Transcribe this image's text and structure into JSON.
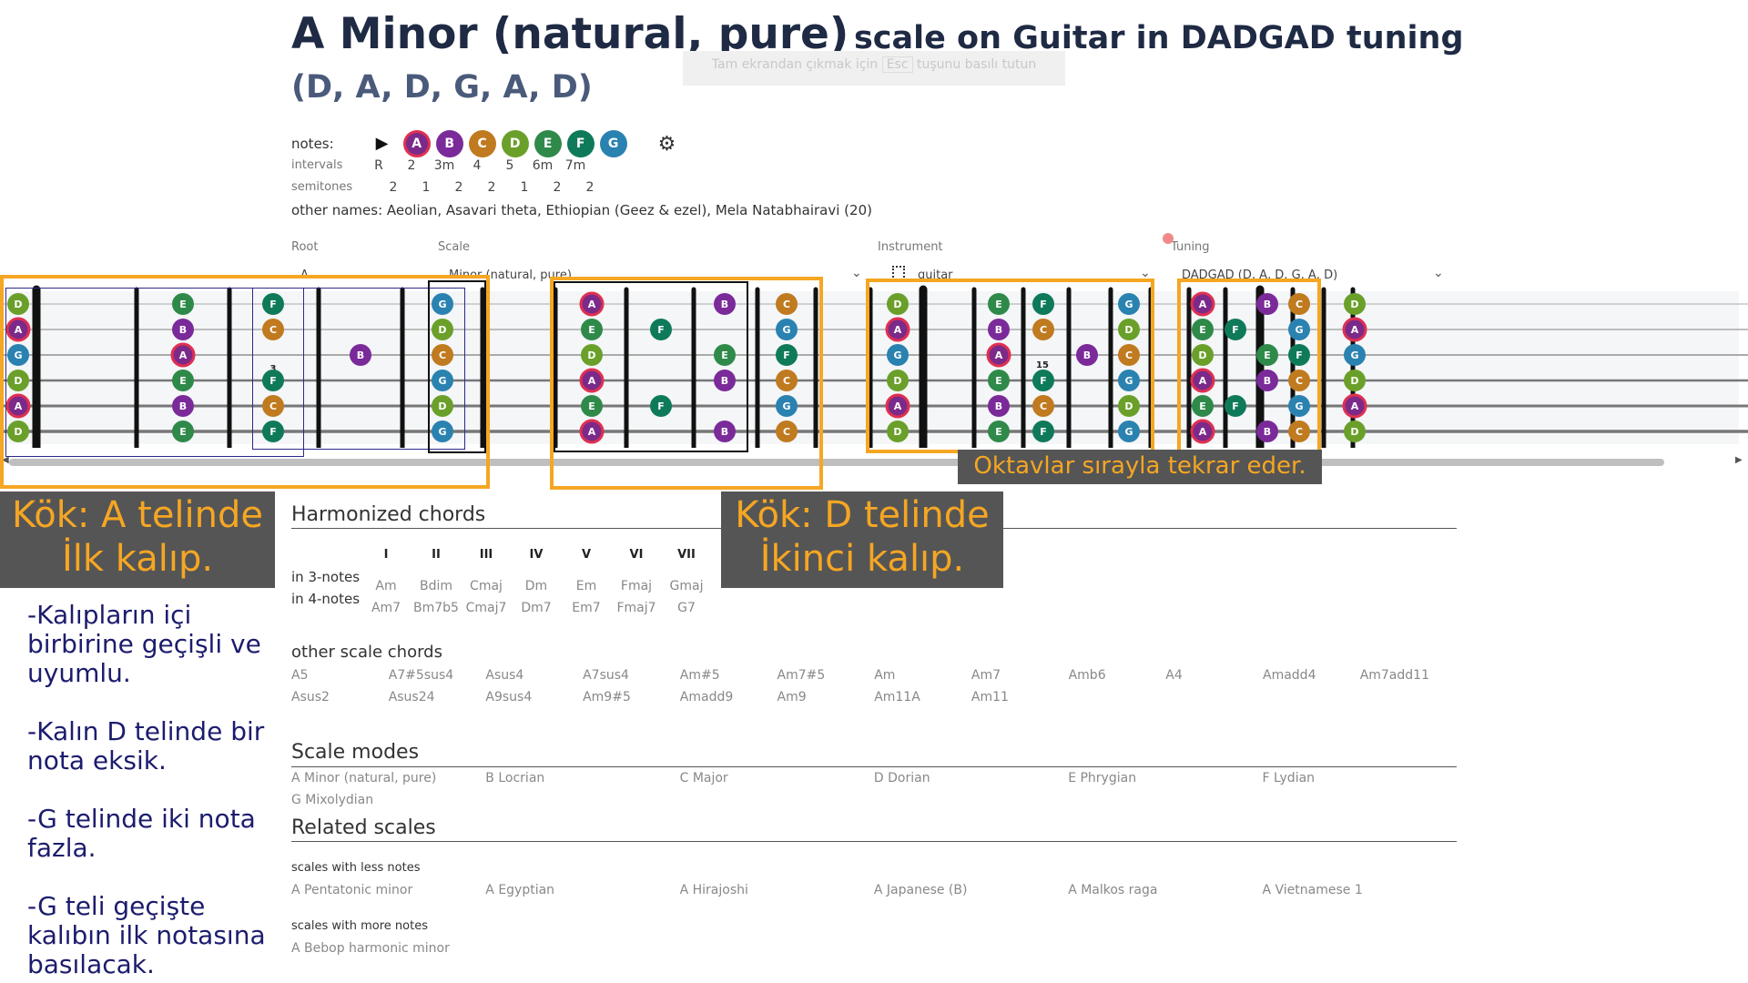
{
  "title": {
    "scale_name": "A Minor (natural, pure)",
    "rest": "scale on Guitar in DADGAD tuning",
    "tuning_notes": "(D, A, D, G, A, D)"
  },
  "toast": {
    "text": "Tam ekrandan çıkmak için",
    "key": "Esc",
    "suffix": "tuşunu basılı tutun"
  },
  "notes_label": "notes:",
  "notes": [
    {
      "n": "A",
      "color": "#7b2a8a",
      "root": true
    },
    {
      "n": "B",
      "color": "#7b2a9a",
      "root": false
    },
    {
      "n": "C",
      "color": "#c07a1f",
      "root": false
    },
    {
      "n": "D",
      "color": "#6aa02a",
      "root": false
    },
    {
      "n": "E",
      "color": "#2f8a4a",
      "root": false
    },
    {
      "n": "F",
      "color": "#0f7a5a",
      "root": false
    },
    {
      "n": "G",
      "color": "#2a82b0",
      "root": false
    }
  ],
  "intervals_label": "intervals",
  "intervals": [
    "R",
    "2",
    "3m",
    "4",
    "5",
    "6m",
    "7m"
  ],
  "semitones_label": "semitones",
  "semitones": [
    "2",
    "1",
    "2",
    "2",
    "1",
    "2",
    "2"
  ],
  "other_names": "other names: Aeolian, Asavari theta, Ethiopian (Geez & ezel), Mela Natabhairavi (20)",
  "selectors": {
    "root_label": "Root",
    "root_value": "A",
    "scale_label": "Scale",
    "scale_value": "Minor (natural, pure)",
    "instrument_label": "Instrument",
    "instrument_value": "guitar",
    "tuning_label": "Tuning",
    "tuning_value": "DADGAD (D, A, D, G, A, D)"
  },
  "fretboard": {
    "strings": [
      "D",
      "A",
      "G",
      "D",
      "A",
      "D"
    ],
    "fret_labels": [
      "3",
      "15"
    ],
    "colors": {
      "D": "#6aa02a",
      "A": "#7b2a8a",
      "B": "#7b2a9a",
      "C": "#c07a1f",
      "E": "#2f8a4a",
      "F": "#0f7a5a",
      "G": "#2a82b0"
    }
  },
  "callouts": {
    "left_line1": "Kök: A telinde",
    "left_line2": "İlk kalıp.",
    "mid_line1": "Kök: D telinde",
    "mid_line2": "İkinci kalıp.",
    "banner": "Oktavlar sırayla tekrar eder."
  },
  "notes_side": [
    "-Kalıpların içi birbirine geçişli ve uyumlu.",
    "-Kalın D telinde bir nota eksik.",
    "-G telinde iki nota fazla.",
    "-G teli geçişte kalıbın ilk notasına basılacak."
  ],
  "harmonized": {
    "heading": "Harmonized chords",
    "row3_label": "in 3-notes",
    "row4_label": "in 4-notes",
    "cols": [
      {
        "r": "I",
        "c3": "Am",
        "c4": "Am7"
      },
      {
        "r": "II",
        "c3": "Bdim",
        "c4": "Bm7b5"
      },
      {
        "r": "III",
        "c3": "Cmaj",
        "c4": "Cmaj7"
      },
      {
        "r": "IV",
        "c3": "Dm",
        "c4": "Dm7"
      },
      {
        "r": "V",
        "c3": "Em",
        "c4": "Em7"
      },
      {
        "r": "VI",
        "c3": "Fmaj",
        "c4": "Fmaj7"
      },
      {
        "r": "VII",
        "c3": "Gmaj",
        "c4": "G7"
      }
    ]
  },
  "other_chords": {
    "heading": "other scale chords",
    "row1": [
      "A5",
      "A7#5sus4",
      "Asus4",
      "A7sus4",
      "Am#5",
      "Am7#5",
      "Am",
      "Am7",
      "Amb6",
      "A4",
      "Amadd4",
      "Am7add11"
    ],
    "row2": [
      "Asus2",
      "Asus24",
      "A9sus4",
      "Am9#5",
      "Amadd9",
      "Am9",
      "Am11A",
      "Am11"
    ]
  },
  "modes": {
    "heading": "Scale modes",
    "row1": [
      "A Minor (natural, pure)",
      "B Locrian",
      "C Major",
      "D Dorian",
      "E Phrygian",
      "F Lydian"
    ],
    "row2": [
      "G Mixolydian"
    ]
  },
  "related": {
    "heading": "Related scales",
    "less_label": "scales with less notes",
    "less": [
      "A Pentatonic minor",
      "A Egyptian",
      "A Hirajoshi",
      "A Japanese (B)",
      "A Malkos raga",
      "A Vietnamese 1"
    ],
    "more_label": "scales with more notes",
    "more": [
      "A Bebop harmonic minor"
    ]
  }
}
